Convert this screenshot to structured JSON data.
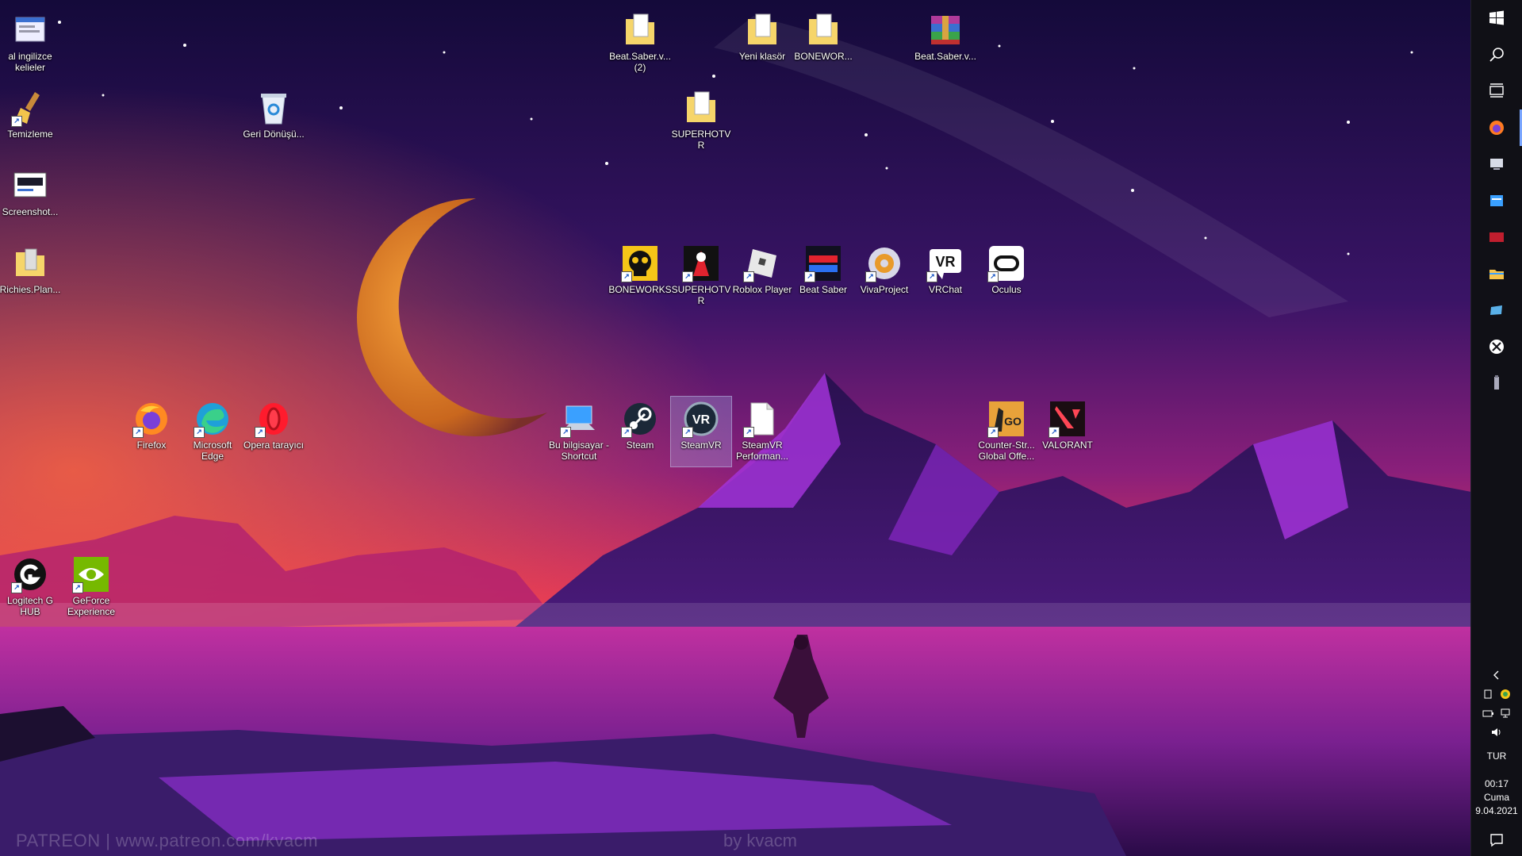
{
  "desktop": {
    "icons": [
      {
        "id": "al-ingilizce",
        "label": "al ingilizce kelieler",
        "shortcut": false
      },
      {
        "id": "temizleme",
        "label": "Temizleme",
        "shortcut": true
      },
      {
        "id": "screenshot",
        "label": "Screenshot...",
        "shortcut": false
      },
      {
        "id": "richies",
        "label": "Richies.Plan...",
        "shortcut": false
      },
      {
        "id": "geri-donusum",
        "label": "Geri Dönüşü...",
        "shortcut": false
      },
      {
        "id": "beatsaber-folder-2",
        "label": "Beat.Saber.v... (2)",
        "shortcut": false
      },
      {
        "id": "yeni-klasor",
        "label": "Yeni klasör",
        "shortcut": false
      },
      {
        "id": "bonework-folder",
        "label": "BONEWOR...",
        "shortcut": false
      },
      {
        "id": "beatsaber-rar",
        "label": "Beat.Saber.v...",
        "shortcut": false
      },
      {
        "id": "superhotvr-folder",
        "label": "SUPERHOTVR",
        "shortcut": false
      },
      {
        "id": "boneworks",
        "label": "BONEWORKS",
        "shortcut": true
      },
      {
        "id": "superhotvr",
        "label": "SUPERHOTVR",
        "shortcut": true
      },
      {
        "id": "roblox",
        "label": "Roblox Player",
        "shortcut": true
      },
      {
        "id": "beat-saber",
        "label": "Beat Saber",
        "shortcut": true
      },
      {
        "id": "vivaproject",
        "label": "VivaProject",
        "shortcut": true
      },
      {
        "id": "vrchat",
        "label": "VRChat",
        "shortcut": true
      },
      {
        "id": "oculus",
        "label": "Oculus",
        "shortcut": true
      },
      {
        "id": "firefox",
        "label": "Firefox",
        "shortcut": true
      },
      {
        "id": "edge",
        "label": "Microsoft Edge",
        "shortcut": true
      },
      {
        "id": "opera",
        "label": "Opera tarayıcı",
        "shortcut": true
      },
      {
        "id": "bu-bilgisayar",
        "label": "Bu bilgisayar - Shortcut",
        "shortcut": true
      },
      {
        "id": "steam",
        "label": "Steam",
        "shortcut": true
      },
      {
        "id": "steamvr",
        "label": "SteamVR",
        "shortcut": true,
        "selected": true
      },
      {
        "id": "steamvr-perf",
        "label": "SteamVR Performan...",
        "shortcut": true
      },
      {
        "id": "csgo",
        "label": "Counter-Str... Global Offe...",
        "shortcut": true
      },
      {
        "id": "valorant",
        "label": "VALORANT",
        "shortcut": true
      },
      {
        "id": "logitech",
        "label": "Logitech G HUB",
        "shortcut": true
      },
      {
        "id": "geforce",
        "label": "GeForce Experience",
        "shortcut": true
      }
    ],
    "watermark_left": "PATREON | www.patreon.com/kvacm",
    "watermark_center": "by kvacm"
  },
  "taskbar": {
    "language": "TUR",
    "time": "00:17",
    "day": "Cuma",
    "date": "9.04.2021"
  },
  "colors": {
    "taskbar_bg": "#101016",
    "accent": "#7aa6ff"
  }
}
